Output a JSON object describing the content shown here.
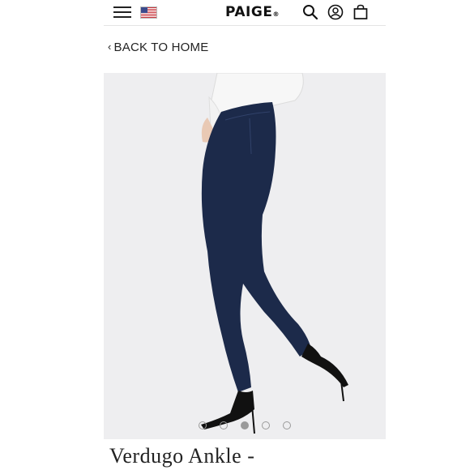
{
  "header": {
    "brand": "PAIGE",
    "brand_mark": "®",
    "menu_icon": "hamburger-menu-icon",
    "flag_icon": "us-flag-icon",
    "search_icon": "search-icon",
    "account_icon": "user-account-icon",
    "bag_icon": "shopping-bag-icon"
  },
  "nav": {
    "back_label": "BACK TO HOME"
  },
  "product": {
    "title": "Verdugo Ankle -",
    "gallery_count": 5,
    "gallery_active_index": 2
  },
  "colors": {
    "denim": "#1c2a4a",
    "background": "#eeeef0"
  }
}
